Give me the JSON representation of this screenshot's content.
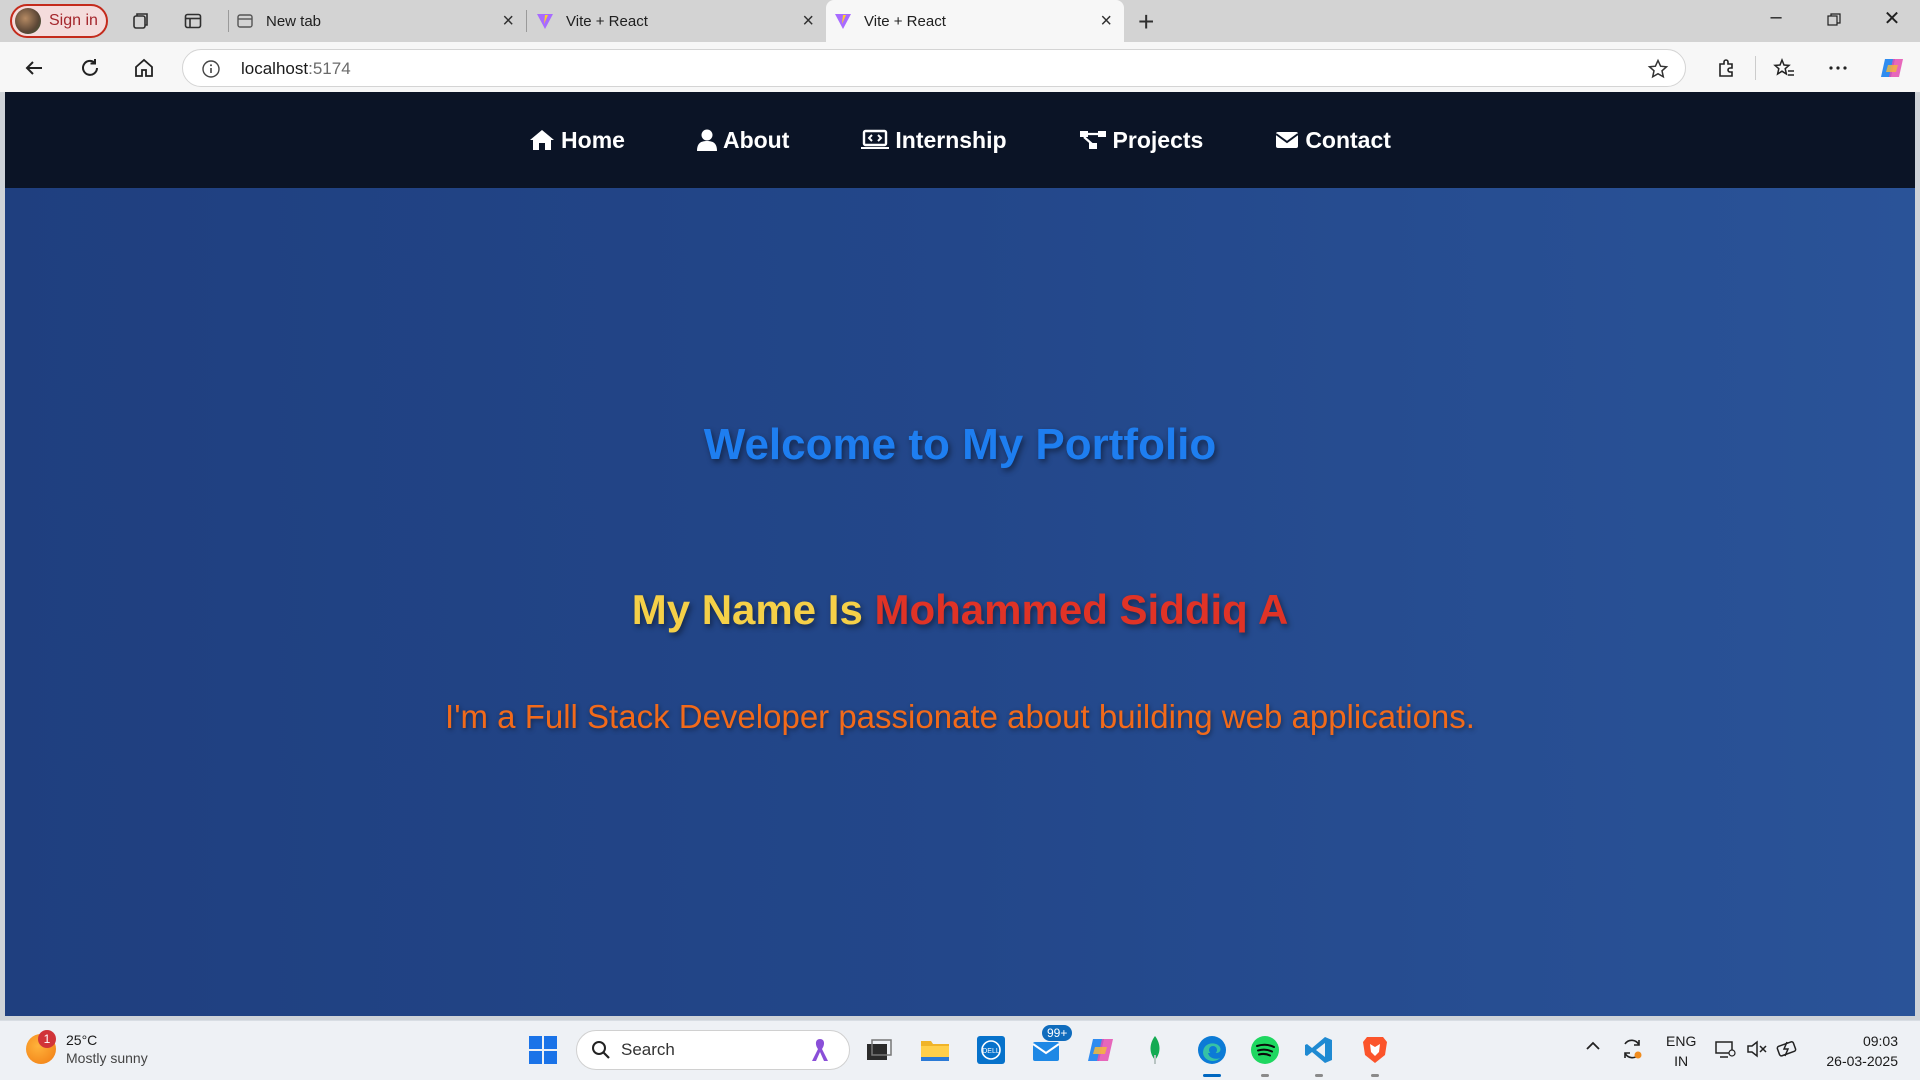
{
  "browser": {
    "signin_label": "Sign in",
    "tabs": [
      {
        "title": "New tab",
        "active": false
      },
      {
        "title": "Vite + React",
        "active": false
      },
      {
        "title": "Vite + React",
        "active": true
      }
    ],
    "address": {
      "host": "localhost",
      "port": ":5174"
    }
  },
  "page": {
    "nav": [
      {
        "label": "Home",
        "icon": "home-icon"
      },
      {
        "label": "About",
        "icon": "user-icon"
      },
      {
        "label": "Internship",
        "icon": "laptop-code-icon"
      },
      {
        "label": "Projects",
        "icon": "project-diagram-icon"
      },
      {
        "label": "Contact",
        "icon": "envelope-icon"
      }
    ],
    "hero": {
      "title": "Welcome to My Portfolio",
      "name_prefix": "My Name Is",
      "name": "Mohammed Siddiq A",
      "subtitle": "I'm a Full Stack Developer passionate about building web applications."
    },
    "colors": {
      "title": "#1e7ef0",
      "name_prefix": "#f5d048",
      "name": "#e03326",
      "subtitle": "#f26a1a",
      "navbar": "#0b1426",
      "background": "#23478a"
    }
  },
  "taskbar": {
    "weather": {
      "temp": "25°C",
      "condition": "Mostly sunny",
      "badge": "1"
    },
    "search_label": "Search",
    "mail_badge": "99+",
    "lang": {
      "line1": "ENG",
      "line2": "IN"
    },
    "time": "09:03",
    "date": "26-03-2025"
  }
}
